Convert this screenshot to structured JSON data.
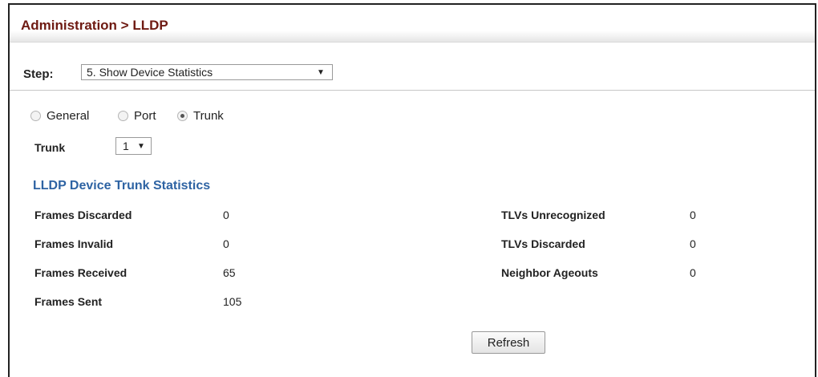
{
  "header": {
    "title": "Administration > LLDP"
  },
  "step": {
    "label": "Step:",
    "selected": "5. Show Device Statistics"
  },
  "mode": {
    "options": [
      "General",
      "Port",
      "Trunk"
    ],
    "selected": "Trunk"
  },
  "trunk": {
    "label": "Trunk",
    "selected": "1"
  },
  "section": {
    "title": "LLDP Device Trunk Statistics"
  },
  "stats_left": [
    {
      "label": "Frames Discarded",
      "value": "0"
    },
    {
      "label": "Frames Invalid",
      "value": "0"
    },
    {
      "label": "Frames Received",
      "value": "65"
    },
    {
      "label": "Frames Sent",
      "value": "105"
    }
  ],
  "stats_right": [
    {
      "label": "TLVs Unrecognized",
      "value": "0"
    },
    {
      "label": "TLVs Discarded",
      "value": "0"
    },
    {
      "label": "Neighbor Ageouts",
      "value": "0"
    }
  ],
  "buttons": {
    "refresh": "Refresh"
  },
  "colors": {
    "title": "#6e1a12",
    "section_title": "#2e63a3"
  }
}
